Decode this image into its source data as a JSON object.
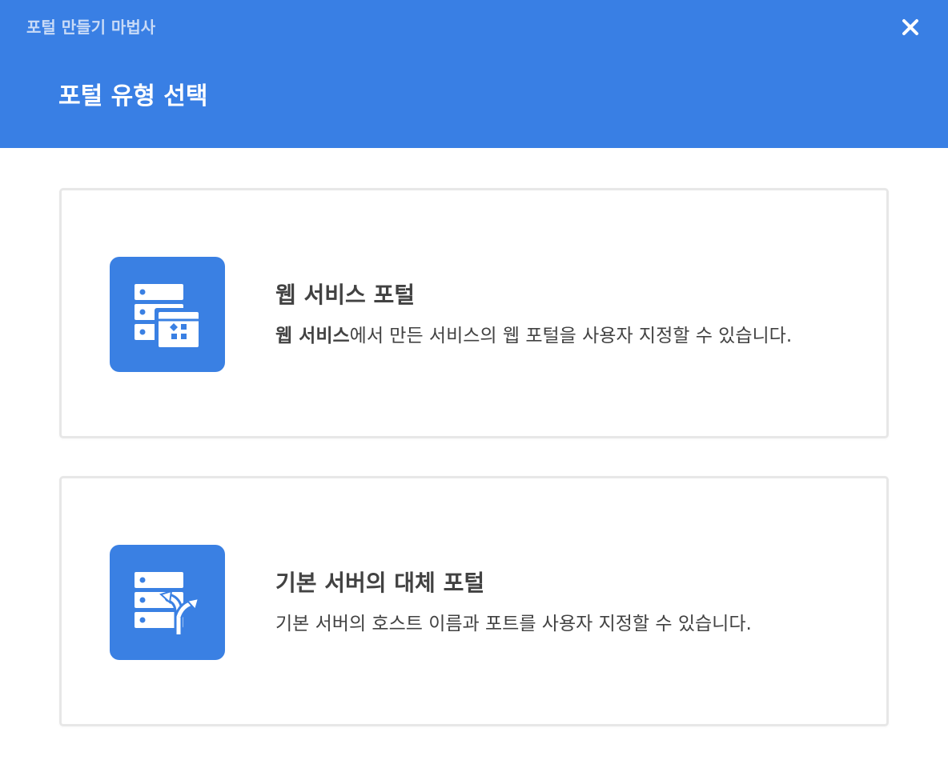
{
  "dialog": {
    "wizard_title": "포털 만들기 마법사",
    "step_title": "포털 유형 선택",
    "close_icon": "close-icon"
  },
  "colors": {
    "header_bg": "#397fe4",
    "icon_bg": "#3a80e3",
    "text": "#424242",
    "card_border": "#e7e7e7"
  },
  "options": [
    {
      "icon": "web-service-portal-icon",
      "title": "웹 서비스 포털",
      "desc_bold": "웹 서비스",
      "desc_rest": "에서 만든 서비스의 웹 포털을 사용자 지정할 수 있습니다."
    },
    {
      "icon": "fallback-portal-icon",
      "title": "기본 서버의 대체 포털",
      "desc": "기본 서버의 호스트 이름과 포트를 사용자 지정할 수 있습니다."
    }
  ]
}
